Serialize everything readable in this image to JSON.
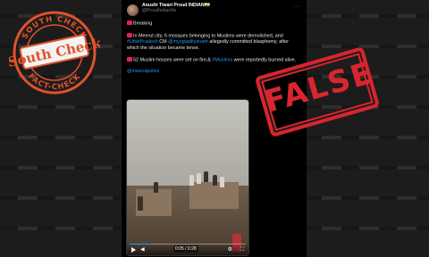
{
  "tweet": {
    "display_name": "Anushi Tiwari Proud INDIAN🇮🇳",
    "handle": "@ProudIndianNe",
    "more_glyph": "···",
    "line1": "Breaking",
    "para2_prefix": "In Meerut city, 6 mosques belonging to Muslims were demolished, and ",
    "hashtag_up": "#UttarPradesh",
    "para2_mid": " CM ",
    "mention_cm": "@myogiadityanath",
    "para2_suffix": " allegedly committed blasphemy, after which the situation became tense.",
    "para3_prefix": "52 Muslim houses were set on fire,& ",
    "hashtag_muslims": "#Muslims",
    "para3_suffix": " were reportedly burned alive.",
    "mention_police": "@meerutpolice"
  },
  "video": {
    "time": "0:05 / 0:28",
    "progress_fraction": 0.18
  },
  "stamp": {
    "top_text": "SOUTH CHECK",
    "bottom_text": "FACT-CHECK",
    "logo_text": "South Check"
  },
  "verdict": "FALSE",
  "colors": {
    "verdict_red": "#d9252f",
    "link_blue": "#1d9bf0",
    "stamp_orange": "#e0522b"
  }
}
